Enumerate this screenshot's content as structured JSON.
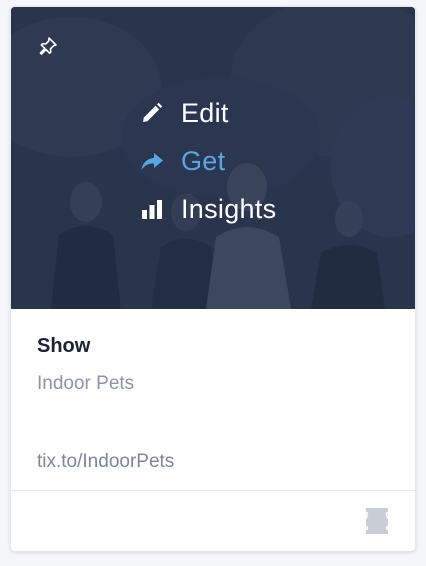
{
  "card": {
    "menu": {
      "items": [
        {
          "label": "Edit",
          "icon": "pencil-icon"
        },
        {
          "label": "Get",
          "icon": "share-arrow-icon",
          "active": true
        },
        {
          "label": "Insights",
          "icon": "bar-chart-icon"
        }
      ]
    },
    "pin_icon": "pin-icon",
    "type_label": "Show",
    "name": "Indoor Pets",
    "link": "tix.to/IndoorPets",
    "ticket_icon": "ticket-icon"
  },
  "colors": {
    "overlay": "#2d3a52",
    "accent": "#5aa6e3",
    "text_primary": "#1b2232",
    "text_secondary": "#8b95a6",
    "icon_muted": "#c9ced6"
  }
}
